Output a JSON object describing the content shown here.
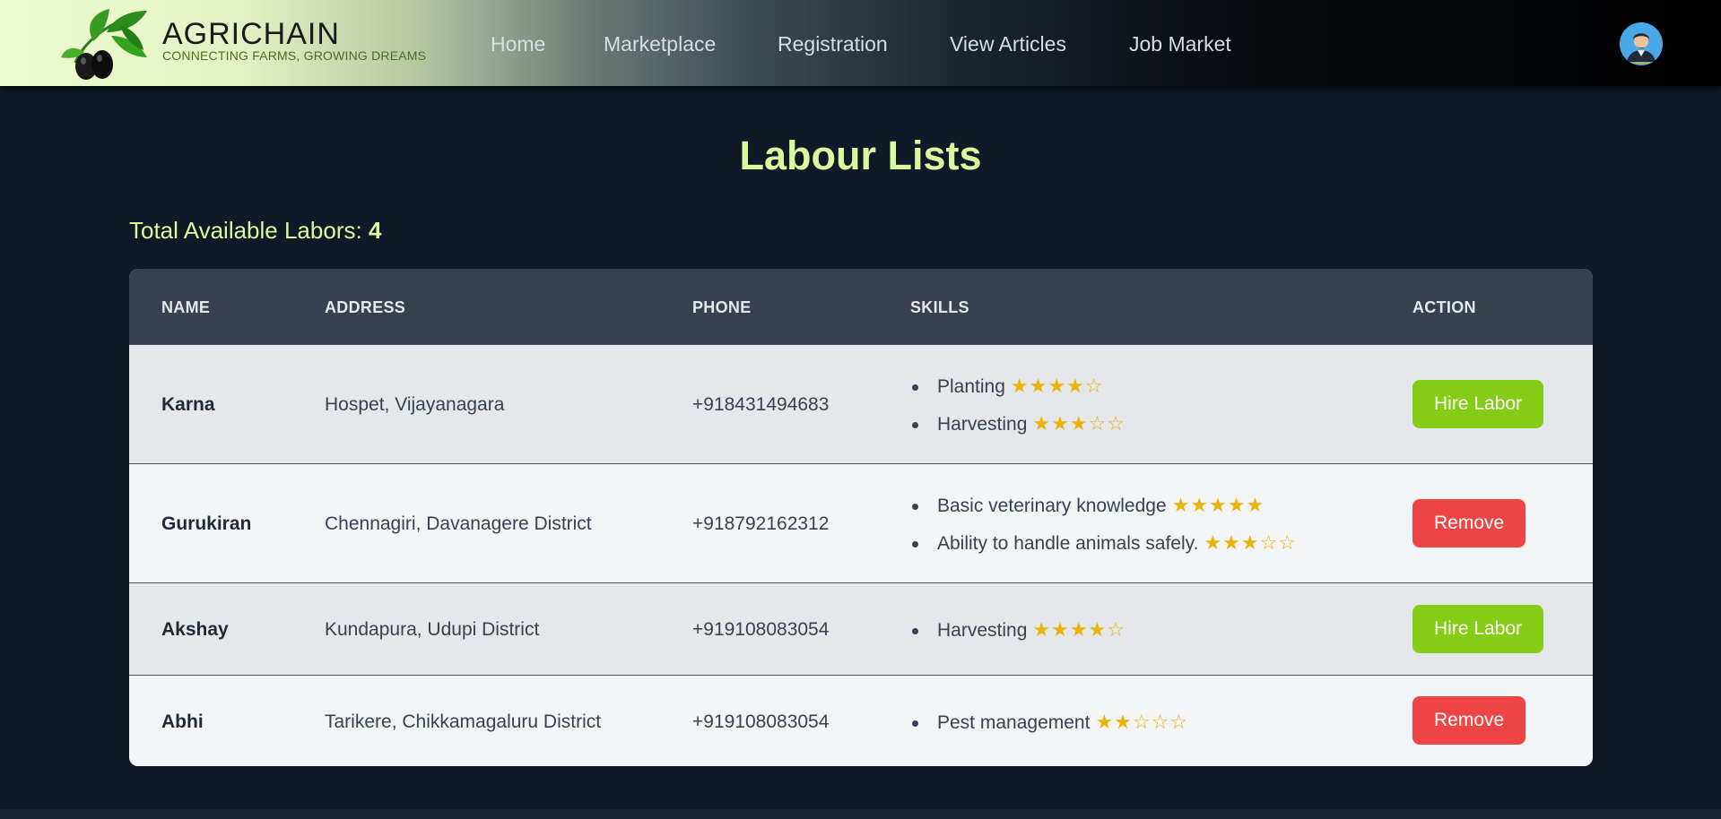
{
  "brand": {
    "name": "AGRICHAIN",
    "tagline": "CONNECTING FARMS, GROWING DREAMS",
    "logo_icon": "olive-branch-icon"
  },
  "nav": {
    "links": [
      "Home",
      "Marketplace",
      "Registration",
      "View Articles",
      "Job Market"
    ]
  },
  "user": {
    "avatar_icon": "user-avatar-icon"
  },
  "page": {
    "title": "Labour Lists",
    "total_label": "Total Available Labors:",
    "total_count": "4"
  },
  "table": {
    "headers": {
      "name": "NAME",
      "address": "ADDRESS",
      "phone": "PHONE",
      "skills": "SKILLS",
      "action": "ACTION"
    },
    "rows": [
      {
        "name": "Karna",
        "address": "Hospet, Vijayanagara",
        "phone": "+918431494683",
        "skills": [
          {
            "label": "Planting",
            "stars": "★★★★☆",
            "rating": 4
          },
          {
            "label": "Harvesting",
            "stars": "★★★☆☆",
            "rating": 3
          }
        ],
        "action": "Hire Labor",
        "action_type": "hire"
      },
      {
        "name": "Gurukiran",
        "address": "Chennagiri, Davanagere District",
        "phone": "+918792162312",
        "skills": [
          {
            "label": "Basic veterinary knowledge",
            "stars": "★★★★★",
            "rating": 5
          },
          {
            "label": "Ability to handle animals safely.",
            "stars": "★★★☆☆",
            "rating": 3
          }
        ],
        "action": "Remove",
        "action_type": "remove"
      },
      {
        "name": "Akshay",
        "address": "Kundapura, Udupi District",
        "phone": "+919108083054",
        "skills": [
          {
            "label": "Harvesting",
            "stars": "★★★★☆",
            "rating": 4
          }
        ],
        "action": "Hire Labor",
        "action_type": "hire"
      },
      {
        "name": "Abhi",
        "address": "Tarikere, Chikkamagaluru District",
        "phone": "+919108083054",
        "skills": [
          {
            "label": "Pest management",
            "stars": "★★☆☆☆",
            "rating": 2
          }
        ],
        "action": "Remove",
        "action_type": "remove"
      }
    ]
  },
  "colors": {
    "page_bg": "#111827",
    "accent_lime": "#d9f99d",
    "hire_button": "#84cc16",
    "remove_button": "#ef4444",
    "star": "#eab308",
    "table_header_bg": "#374151"
  }
}
